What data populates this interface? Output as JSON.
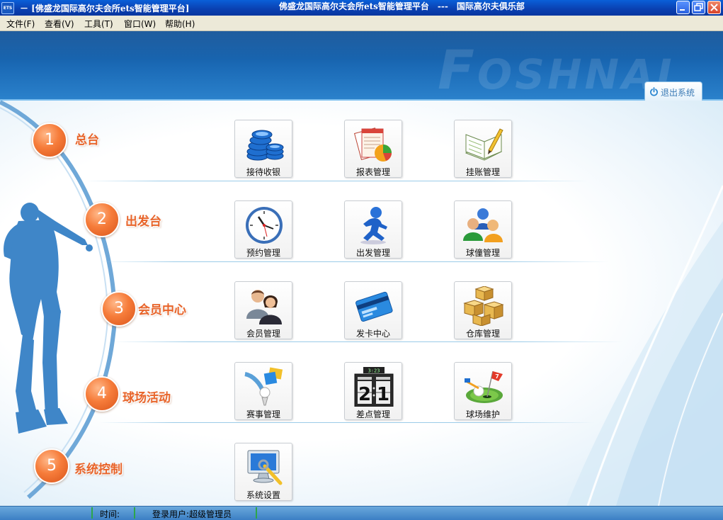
{
  "window": {
    "icon_text": "ETS",
    "title_left": "－ [佛盛龙国际高尔夫会所ets智能管理平台]",
    "title_center": "佛盛龙国际高尔夫会所ets智能管理平台　---　国际高尔夫俱乐部"
  },
  "menu": [
    {
      "label": "文件(F)"
    },
    {
      "label": "查看(V)"
    },
    {
      "label": "工具(T)"
    },
    {
      "label": "窗口(W)"
    },
    {
      "label": "帮助(H)"
    }
  ],
  "header": {
    "brand_first": "F",
    "brand_rest": "OSHNAL",
    "logout_label": "退出系统"
  },
  "sections": [
    {
      "number": "1",
      "label": "总台",
      "tiles": [
        {
          "label": "接待收银",
          "icon": "coins-icon"
        },
        {
          "label": "报表管理",
          "icon": "report-chart-icon"
        },
        {
          "label": "挂账管理",
          "icon": "notebook-pencil-icon"
        }
      ]
    },
    {
      "number": "2",
      "label": "出发台",
      "tiles": [
        {
          "label": "预约管理",
          "icon": "clock-icon"
        },
        {
          "label": "出发管理",
          "icon": "running-person-icon"
        },
        {
          "label": "球僮管理",
          "icon": "people-group-icon"
        }
      ]
    },
    {
      "number": "3",
      "label": "会员中心",
      "tiles": [
        {
          "label": "会员管理",
          "icon": "members-icon"
        },
        {
          "label": "发卡中心",
          "icon": "card-icon"
        },
        {
          "label": "仓库管理",
          "icon": "boxes-icon"
        }
      ]
    },
    {
      "number": "4",
      "label": "球场活动",
      "tiles": [
        {
          "label": "赛事管理",
          "icon": "golf-tee-icon"
        },
        {
          "label": "差点管理",
          "icon": "scoreboard-icon",
          "score_home": "2",
          "score_visitor": "1",
          "score_top": "3:23"
        },
        {
          "label": "球场维护",
          "icon": "golf-green-icon",
          "flag_number": "7"
        }
      ]
    },
    {
      "number": "5",
      "label": "系统控制",
      "tiles": [
        {
          "label": "系统设置",
          "icon": "monitor-settings-icon"
        }
      ]
    }
  ],
  "status": {
    "time_label": "时间:",
    "user_label": "登录用户:超级管理员"
  },
  "colors": {
    "accent_orange": "#e8642a",
    "header_blue": "#1c6cb8",
    "statusbar_blue": "#3b7fc4"
  }
}
